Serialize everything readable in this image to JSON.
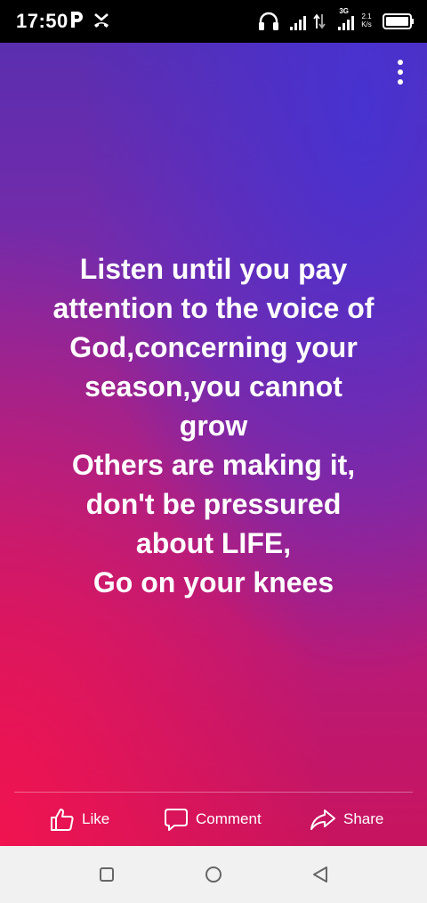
{
  "status_bar": {
    "time": "17:50",
    "network_3g": "3G",
    "speed_value": "2.1",
    "speed_unit": "K/s"
  },
  "icons": {
    "parking": "parking-icon",
    "missed_call": "missed-call-icon",
    "headset": "headset-icon",
    "signal": "signal-icon",
    "battery": "battery-icon",
    "menu": "more-vert-icon",
    "like": "thumbs-up-icon",
    "comment": "comment-icon",
    "share": "share-icon",
    "recents": "square-icon",
    "home": "circle-icon",
    "back": "triangle-back-icon"
  },
  "post": {
    "lines": [
      "Listen until you pay",
      "attention to the voice of",
      "God,concerning your",
      "season,you cannot",
      "grow",
      "Others are making it,",
      "don't be pressured",
      "about LIFE,",
      "Go on your knees"
    ]
  },
  "actions": {
    "like": "Like",
    "comment": "Comment",
    "share": "Share"
  },
  "colors": {
    "gradient_top": "#5a2eb0",
    "gradient_bottom": "#c8145e",
    "status_bar": "#000000",
    "nav_bar": "#f1f1f1"
  }
}
